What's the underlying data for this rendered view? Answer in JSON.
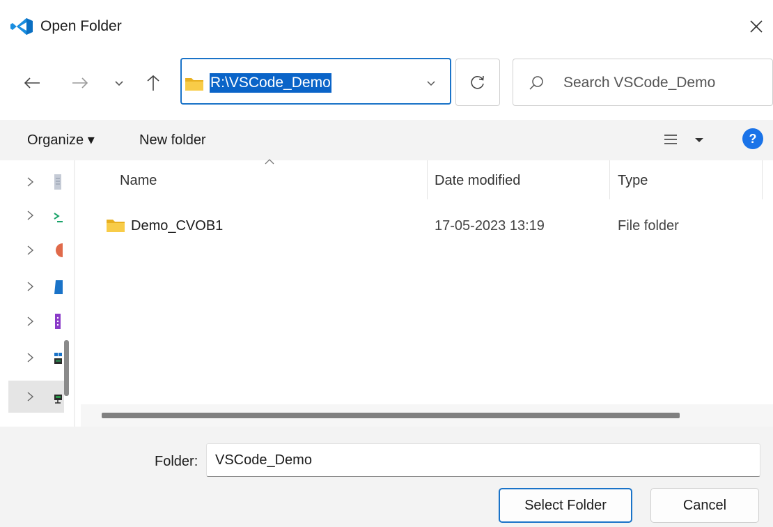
{
  "window": {
    "title": "Open Folder",
    "icon": "vscode-logo-icon",
    "close_icon": "close-icon"
  },
  "nav": {
    "back_icon": "arrow-left-icon",
    "forward_icon": "arrow-right-icon",
    "recent_icon": "chevron-down-icon",
    "up_icon": "arrow-up-icon",
    "address": "R:\\VSCode_Demo",
    "address_dropdown_icon": "chevron-down-icon",
    "refresh_icon": "refresh-icon"
  },
  "search": {
    "placeholder": "Search VSCode_Demo",
    "icon": "search-icon"
  },
  "toolbar": {
    "organize_label": "Organize ▾",
    "new_folder_label": "New folder",
    "view_icon": "list-view-icon",
    "help_label": "?"
  },
  "sidebar": {
    "items": [
      {
        "icon": "document-icon",
        "color": "#9aa4b4"
      },
      {
        "icon": "network-icon",
        "color": "#1aa36a"
      },
      {
        "icon": "disc-icon",
        "color": "#e06a4a"
      },
      {
        "icon": "cloud-icon",
        "color": "#1a73c8"
      },
      {
        "icon": "dotted-icon",
        "color": "#8a3ac8"
      },
      {
        "icon": "drive-icon",
        "color": "#2a7a4a"
      },
      {
        "icon": "network-drive-icon",
        "color": "#2a7a4a",
        "selected": true
      }
    ]
  },
  "file_list": {
    "columns": [
      "Name",
      "Date modified",
      "Type"
    ],
    "rows": [
      {
        "name": "Demo_CVOB1",
        "date_modified": "17-05-2023 13:19",
        "type": "File folder",
        "icon": "folder-icon"
      }
    ]
  },
  "footer": {
    "folder_label": "Folder:",
    "folder_value": "VSCode_Demo",
    "select_label": "Select Folder",
    "cancel_label": "Cancel"
  },
  "colors": {
    "accent": "#1a73c8",
    "selection": "#0a64c8",
    "folder": "#f5c542",
    "toolbar_bg": "#f3f3f3"
  }
}
